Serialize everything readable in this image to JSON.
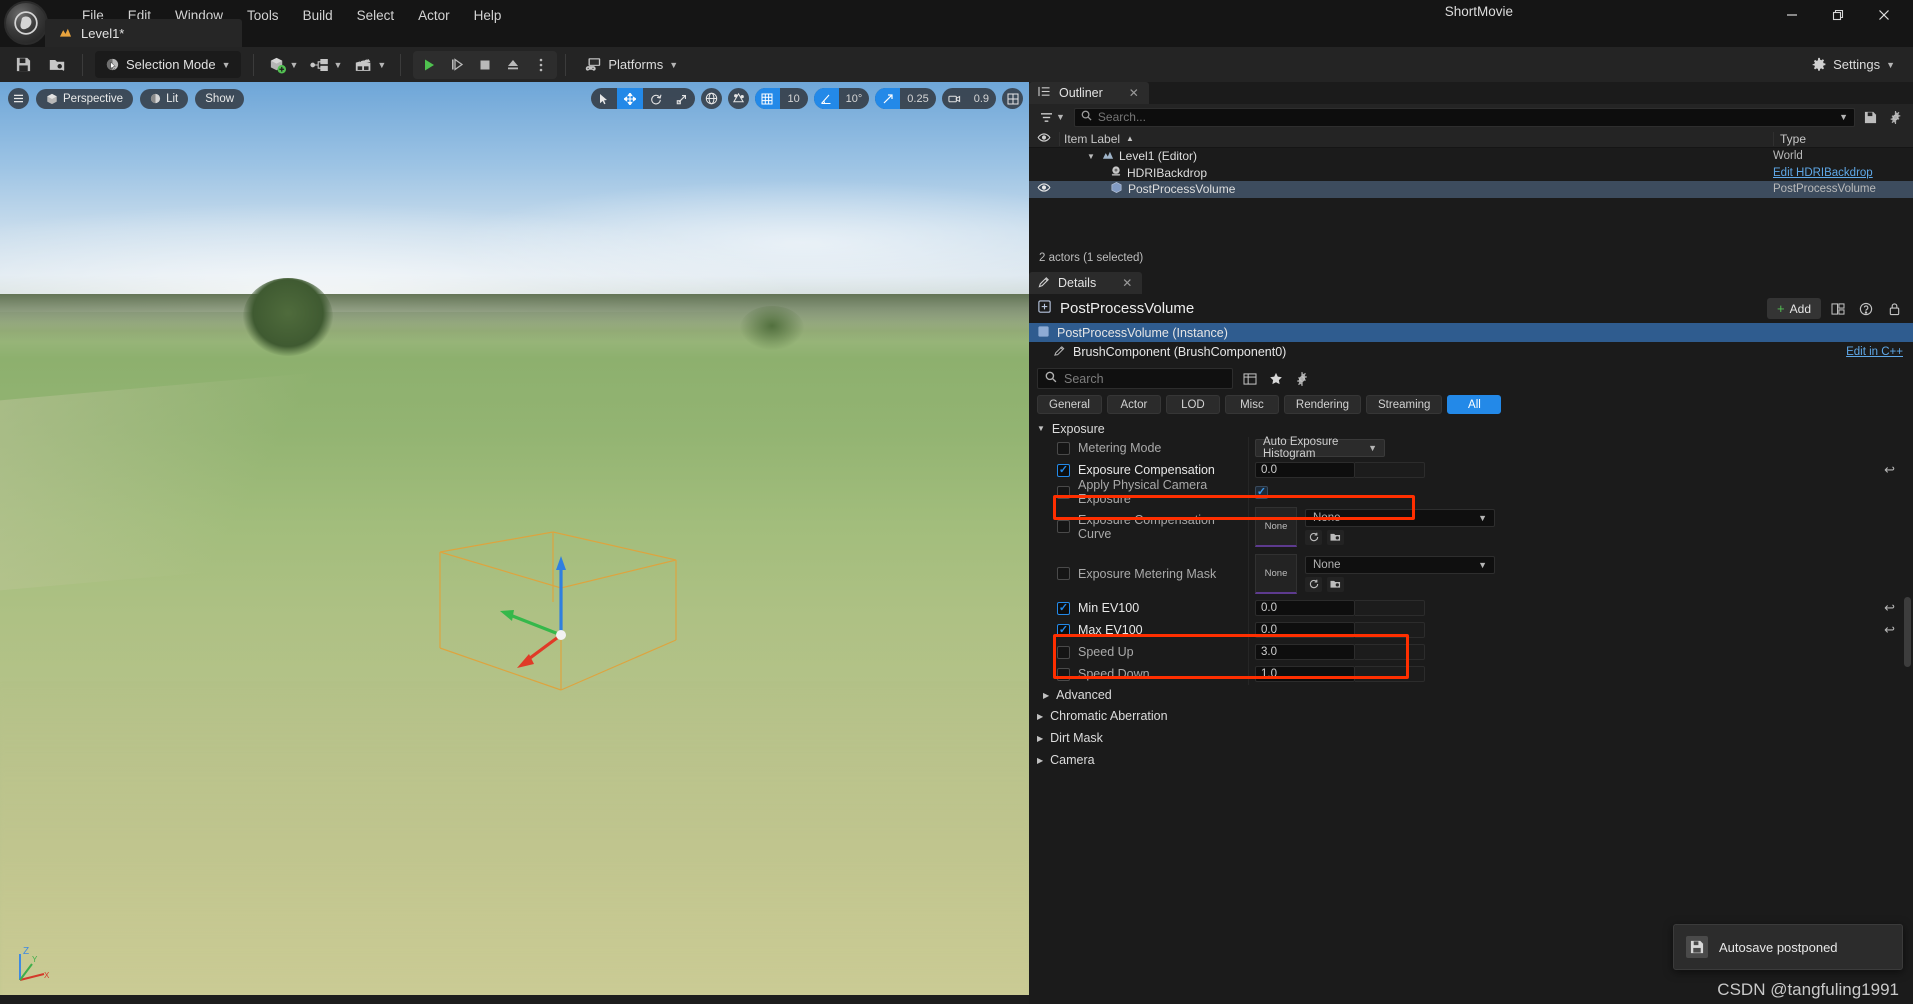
{
  "titlebar": {
    "logo_icon": "unreal-engine-logo",
    "window_title": "ShortMovie",
    "menu": [
      "File",
      "Edit",
      "Window",
      "Tools",
      "Build",
      "Select",
      "Actor",
      "Help"
    ],
    "level_tab": {
      "label": "Level1*",
      "icon": "level-icon"
    },
    "window_buttons": {
      "minimize": "–",
      "maximize": "🗗",
      "close": "✕"
    }
  },
  "toolbar": {
    "save_icon": "save-icon",
    "browse_icon": "browse-content-icon",
    "mode_label": "Selection Mode",
    "create_icon": "add-actor-icon",
    "blueprint_icon": "blueprint-icon",
    "cinematics_icon": "cinematics-icon",
    "play": "▶",
    "skip": "⏭",
    "stop": "■",
    "eject": "⏏",
    "more": "⋮",
    "platforms_label": "Platforms",
    "settings_label": "Settings"
  },
  "viewport": {
    "menu_icon": "viewport-menu-icon",
    "perspective_label": "Perspective",
    "lit_label": "Lit",
    "show_label": "Show",
    "transform_tools": [
      "select-icon",
      "move-icon",
      "rotate-icon",
      "scale-icon"
    ],
    "active_transform": "move-icon",
    "coord_icon": "world-coordinate-icon",
    "surface_snap_icon": "surface-snap-icon",
    "grid_snap": {
      "icon": "grid-snap-icon",
      "value": "10",
      "enabled": true
    },
    "angle_snap": {
      "icon": "angle-snap-icon",
      "value": "10°",
      "enabled": true
    },
    "scale_snap": {
      "icon": "scale-snap-icon",
      "value": "0.25",
      "enabled": true
    },
    "camera_speed": {
      "icon": "camera-icon",
      "value": "0.9"
    },
    "layout_icon": "viewport-layout-icon",
    "axis_labels": {
      "z": "Z",
      "y": "Y",
      "x": "X"
    }
  },
  "outliner": {
    "tab_label": "Outliner",
    "tab_close": "✕",
    "filter_icon": "filter-icon",
    "search_placeholder": "Search...",
    "search_value": "",
    "settings_icon": "outliner-settings-icon",
    "save_icon": "outliner-save-icon",
    "columns": {
      "visibility": "eye-icon",
      "label": "Item Label",
      "sort": "▲",
      "type": "Type"
    },
    "rows": [
      {
        "label": "Level1 (Editor)",
        "type": "World",
        "indent": 1,
        "expanded": true,
        "icon": "level-icon",
        "selected": false,
        "eye": false,
        "link": false
      },
      {
        "label": "HDRIBackdrop",
        "type": "Edit HDRIBackdrop",
        "indent": 2,
        "expanded": null,
        "icon": "hdri-icon",
        "selected": false,
        "eye": false,
        "link": true
      },
      {
        "label": "PostProcessVolume",
        "type": "PostProcessVolume",
        "indent": 2,
        "expanded": null,
        "icon": "volume-icon",
        "selected": true,
        "eye": true,
        "link": false
      }
    ],
    "status": "2 actors (1 selected)"
  },
  "details": {
    "tab_label": "Details",
    "tab_close": "✕",
    "header_title": "PostProcessVolume",
    "header_icon": "actor-icon",
    "add_label": "Add",
    "add_plus": "+",
    "grid_icon": "component-grid-icon",
    "help_icon": "help-icon",
    "lock_icon": "lock-icon",
    "components": [
      {
        "label": "PostProcessVolume (Instance)",
        "icon": "actor-icon",
        "selected": true,
        "right": ""
      },
      {
        "label": "BrushComponent (BrushComponent0)",
        "icon": "brush-icon",
        "selected": false,
        "right": "Edit in C++"
      }
    ],
    "search_placeholder": "Search",
    "search_value": "",
    "search_icon": "search-icon",
    "tools": [
      "column-layout-icon",
      "favorite-icon",
      "settings-icon"
    ],
    "filters": [
      {
        "label": "General",
        "active": false
      },
      {
        "label": "Actor",
        "active": false
      },
      {
        "label": "LOD",
        "active": false
      },
      {
        "label": "Misc",
        "active": false
      },
      {
        "label": "Rendering",
        "active": false
      },
      {
        "label": "Streaming",
        "active": false
      },
      {
        "label": "All",
        "active": true
      }
    ],
    "section": {
      "label": "Exposure",
      "expanded": true
    },
    "properties": [
      {
        "name": "Metering Mode",
        "checked": false,
        "enabled": false,
        "kind": "combo",
        "value": "Auto Exposure Histogram",
        "reset": false,
        "highlight": false
      },
      {
        "name": "Exposure Compensation",
        "checked": true,
        "enabled": true,
        "kind": "number",
        "value": "0.0",
        "reset": true,
        "highlight": true
      },
      {
        "name": "Apply Physical Camera Exposure",
        "checked": false,
        "enabled": false,
        "kind": "bool",
        "value": true,
        "reset": false,
        "highlight": false
      },
      {
        "name": "Exposure Compensation Curve",
        "checked": false,
        "enabled": false,
        "kind": "asset",
        "value": "None",
        "thumb": "None",
        "reset": false,
        "highlight": false
      },
      {
        "name": "Exposure Metering Mask",
        "checked": false,
        "enabled": false,
        "kind": "asset",
        "value": "None",
        "thumb": "None",
        "reset": false,
        "highlight": false
      },
      {
        "name": "Min EV100",
        "checked": true,
        "enabled": true,
        "kind": "number",
        "value": "0.0",
        "reset": true,
        "highlight": true
      },
      {
        "name": "Max EV100",
        "checked": true,
        "enabled": true,
        "kind": "number",
        "value": "0.0",
        "reset": true,
        "highlight": true
      },
      {
        "name": "Speed Up",
        "checked": false,
        "enabled": false,
        "kind": "number",
        "value": "3.0",
        "reset": false,
        "highlight": false
      },
      {
        "name": "Speed Down",
        "checked": false,
        "enabled": false,
        "kind": "number",
        "value": "1.0",
        "reset": false,
        "highlight": false
      }
    ],
    "collapsed_sections": [
      {
        "label": "Advanced",
        "indent": 1
      },
      {
        "label": "Chromatic Aberration",
        "indent": 0
      },
      {
        "label": "Dirt Mask",
        "indent": 0
      },
      {
        "label": "Camera",
        "indent": 0
      }
    ]
  },
  "toast": {
    "icon": "save-icon",
    "message": "Autosave postponed"
  },
  "watermark": "CSDN @tangfuling1991",
  "colors": {
    "accent_blue": "#2389e8",
    "highlight_red": "#ff2f00",
    "selection_blue": "#3d4c5e",
    "link_blue": "#5fa8e8",
    "green": "#53c153"
  }
}
